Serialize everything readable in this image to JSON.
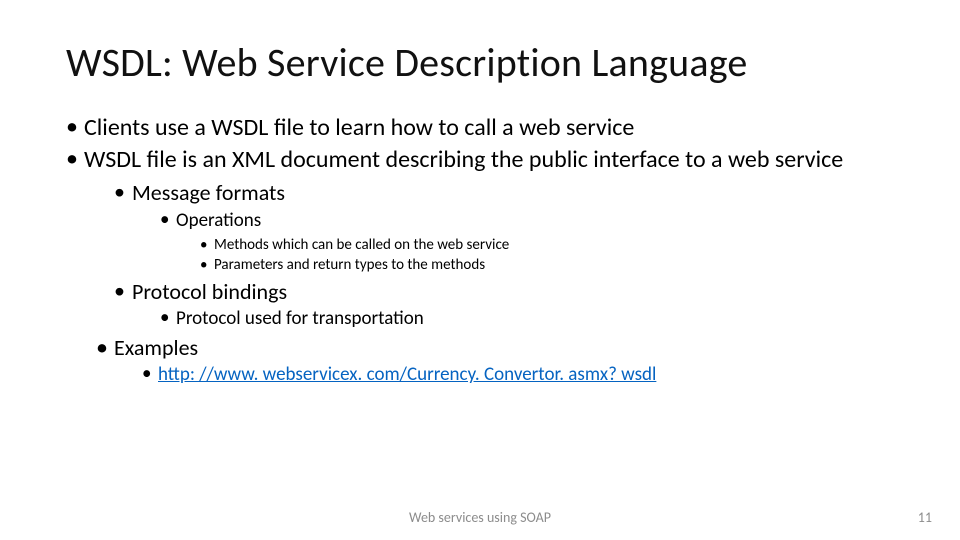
{
  "title": "WSDL: Web Service Description Language",
  "bullets": {
    "b1": "Clients use a WSDL file to learn how to call a web service",
    "b2": "WSDL file is an XML document describing the public interface to a web service",
    "b2_1": "Message formats",
    "b2_1_1": "Operations",
    "b2_1_1_1": "Methods which can be called on the web service",
    "b2_1_1_2": "Parameters and return types to the methods",
    "b2_2": "Protocol bindings",
    "b2_2_1": "Protocol used for transportation",
    "b3": "Examples",
    "b3_1": "http: //www. webservicex. com/Currency. Convertor. asmx? wsdl"
  },
  "footer_center": "Web services using SOAP",
  "page_number": "11"
}
